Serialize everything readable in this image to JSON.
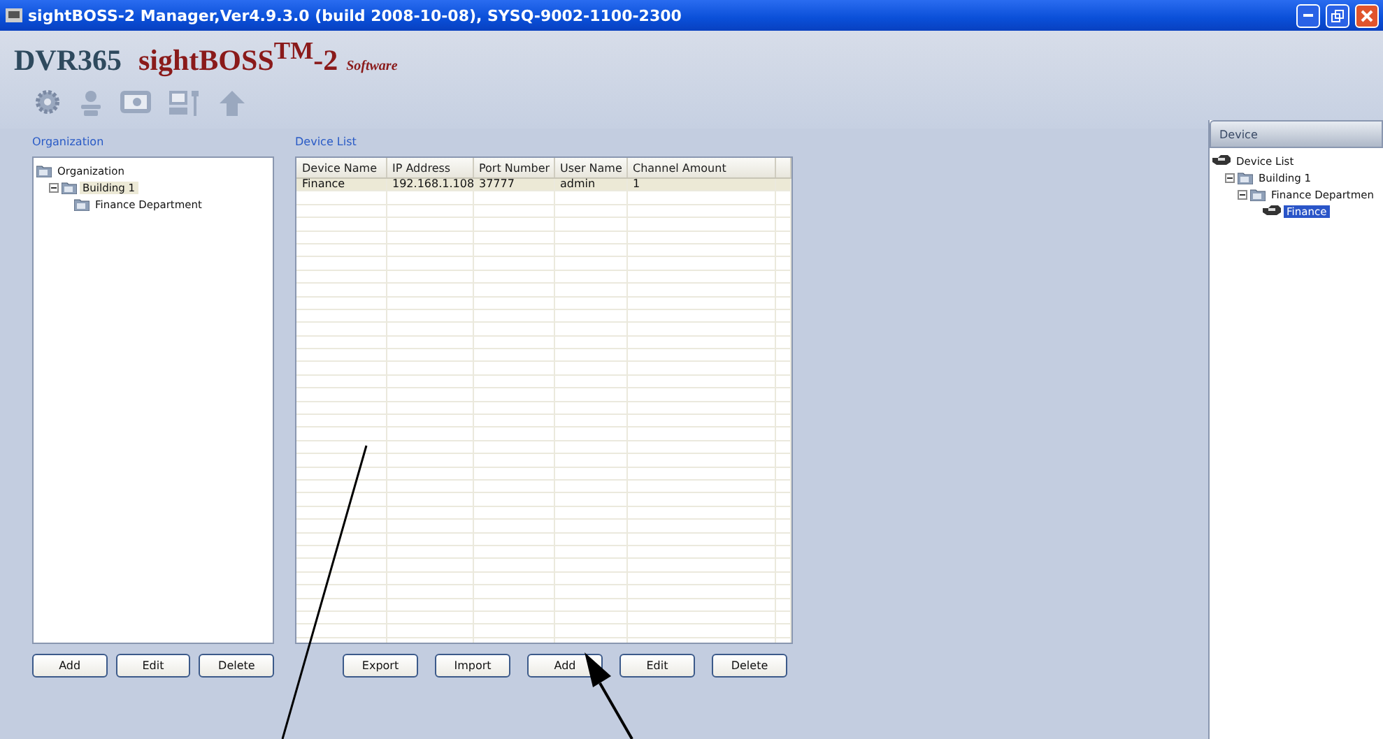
{
  "window": {
    "title": "sightBOSS-2 Manager,Ver4.9.3.0 (build 2008-10-08), SYSQ-9002-1100-2300"
  },
  "brand": {
    "name": "DVR365",
    "product": "sightBOSS",
    "trademark": "TM",
    "version": "-2",
    "suffix": "Software"
  },
  "toolbar": [
    {
      "kind": "gear"
    },
    {
      "kind": "person"
    },
    {
      "kind": "monitor"
    },
    {
      "kind": "tools"
    },
    {
      "kind": "up"
    }
  ],
  "organization": {
    "heading": "Organization",
    "tree": [
      {
        "label": "Organization",
        "kind": "folder",
        "selected": false,
        "children": [
          {
            "label": "Building 1",
            "kind": "folder",
            "selected": true,
            "expanded": true,
            "children": [
              {
                "label": "Finance Department",
                "kind": "folder",
                "selected": false
              }
            ]
          }
        ]
      }
    ],
    "buttons": [
      "Add",
      "Edit",
      "Delete"
    ]
  },
  "device_list": {
    "heading": "Device List",
    "columns": [
      "Device Name",
      "IP Address",
      "Port Number",
      "User Name",
      "Channel Amount"
    ],
    "rows": [
      {
        "selected": true,
        "cells": [
          "Finance",
          "192.168.1.108",
          "37777",
          "admin",
          "1"
        ]
      }
    ],
    "buttons": [
      "Export",
      "Import",
      "Add",
      "Edit",
      "Delete"
    ]
  },
  "device_panel": {
    "title": "Device",
    "tree": [
      {
        "label": "Device List",
        "kind": "camera",
        "selected": false,
        "children": [
          {
            "label": "Building 1",
            "kind": "folder",
            "selected": false,
            "expanded": true,
            "children": [
              {
                "label": "Finance Departmen",
                "kind": "folder",
                "selected": false,
                "expanded": true,
                "children": [
                  {
                    "label": "Finance",
                    "kind": "camera",
                    "selected": true
                  }
                ]
              }
            ]
          }
        ]
      }
    ]
  }
}
